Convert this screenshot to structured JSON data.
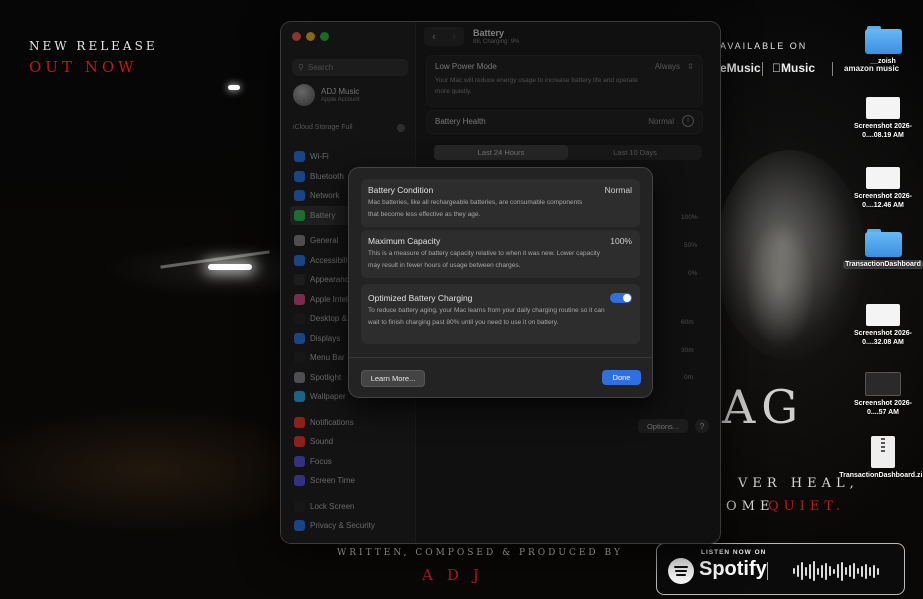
{
  "poster": {
    "new_release": "NEW RELEASE",
    "out_now": "OUT NOW",
    "available_on": "AVAILABLE ON",
    "stores": [
      "eMusic",
      "Music",
      "amazon music"
    ],
    "ag": "AG",
    "tagline_1": "VER HEAL,",
    "tagline_2a": "OME",
    "tagline_2b": "QUIET.",
    "credit": "WRITTEN, COMPOSED & PRODUCED BY",
    "artist": "ADJ",
    "listen_now": "LISTEN NOW ON",
    "spotify": "Spotify",
    "accent_red": "#c01818"
  },
  "window": {
    "title": "Battery",
    "subtitle": "88, Charging: 9%",
    "search_placeholder": "Search",
    "account_name": "ADJ Music",
    "account_sub": "Apple Account",
    "icloud": "iCloud Storage Full",
    "sidebar": [
      {
        "label": "Wi-Fi",
        "color": "#2f7ff0",
        "selected": false
      },
      {
        "label": "Bluetooth",
        "color": "#2f7ff0",
        "selected": false
      },
      {
        "label": "Network",
        "color": "#2f7ff0",
        "selected": false
      },
      {
        "label": "Battery",
        "color": "#34c759",
        "selected": true
      },
      {
        "label": "General",
        "color": "#8e8e93",
        "selected": false
      },
      {
        "label": "Accessibility",
        "color": "#2f7ff0",
        "selected": false
      },
      {
        "label": "Appearance",
        "color": "#333333",
        "selected": false
      },
      {
        "label": "Apple Intelligence",
        "color": "#e0508a",
        "selected": false
      },
      {
        "label": "Desktop & Dock",
        "color": "#2a2a2a",
        "selected": false
      },
      {
        "label": "Displays",
        "color": "#2f7ff0",
        "selected": false
      },
      {
        "label": "Menu Bar",
        "color": "#2a2a2a",
        "selected": false
      },
      {
        "label": "Spotlight",
        "color": "#8e8e93",
        "selected": false
      },
      {
        "label": "Wallpaper",
        "color": "#36b5f0",
        "selected": false
      },
      {
        "label": "Notifications",
        "color": "#ff3b30",
        "selected": false
      },
      {
        "label": "Sound",
        "color": "#ff3b30",
        "selected": false
      },
      {
        "label": "Focus",
        "color": "#5e5ce6",
        "selected": false
      },
      {
        "label": "Screen Time",
        "color": "#5e5ce6",
        "selected": false
      },
      {
        "label": "Lock Screen",
        "color": "#2a2a2a",
        "selected": false
      },
      {
        "label": "Privacy & Security",
        "color": "#2f7ff0",
        "selected": false
      }
    ],
    "low_power_label": "Low Power Mode",
    "low_power_value": "Always",
    "low_power_desc": "Your Mac will reduce energy usage to increase battery life and operate more quietly.",
    "battery_health_label": "Battery Health",
    "battery_health_value": "Normal",
    "seg_24h": "Last 24 Hours",
    "seg_10d": "Last 10 Days",
    "axis_pct": [
      "100%",
      "50%",
      "0%"
    ],
    "axis_min": [
      "60m",
      "30m",
      "0m"
    ],
    "options_label": "Options...",
    "help_label": "?"
  },
  "sheet": {
    "condition_title": "Battery Condition",
    "condition_value": "Normal",
    "condition_desc": "Mac batteries, like all rechargeable batteries, are consumable components that become less effective as they age.",
    "capacity_title": "Maximum Capacity",
    "capacity_value": "100%",
    "capacity_desc": "This is a measure of battery capacity relative to when it was new. Lower capacity may result in fewer hours of usage between charges.",
    "optimized_title": "Optimized Battery Charging",
    "optimized_on": true,
    "optimized_desc": "To reduce battery aging, your Mac learns from your daily charging routine so it can wait to finish charging past 80% until you need to use it on battery.",
    "learn_more": "Learn More...",
    "done": "Done"
  },
  "desktop": {
    "items": [
      {
        "label": "__zoish",
        "kind": "folder",
        "selected": false
      },
      {
        "label": "Screenshot 2026-0....08.19 AM",
        "kind": "thumb",
        "selected": false
      },
      {
        "label": "Screenshot 2026-0....12.46 AM",
        "kind": "thumb",
        "selected": false
      },
      {
        "label": "TransactionDashboard",
        "kind": "folder",
        "selected": true
      },
      {
        "label": "Screenshot 2026-0....32.08 AM",
        "kind": "thumb",
        "selected": false
      },
      {
        "label": "Screenshot 2026-0....57 AM",
        "kind": "thumb-dark",
        "selected": false
      },
      {
        "label": "TransactionDashboard.zip",
        "kind": "zip",
        "selected": false
      }
    ]
  }
}
